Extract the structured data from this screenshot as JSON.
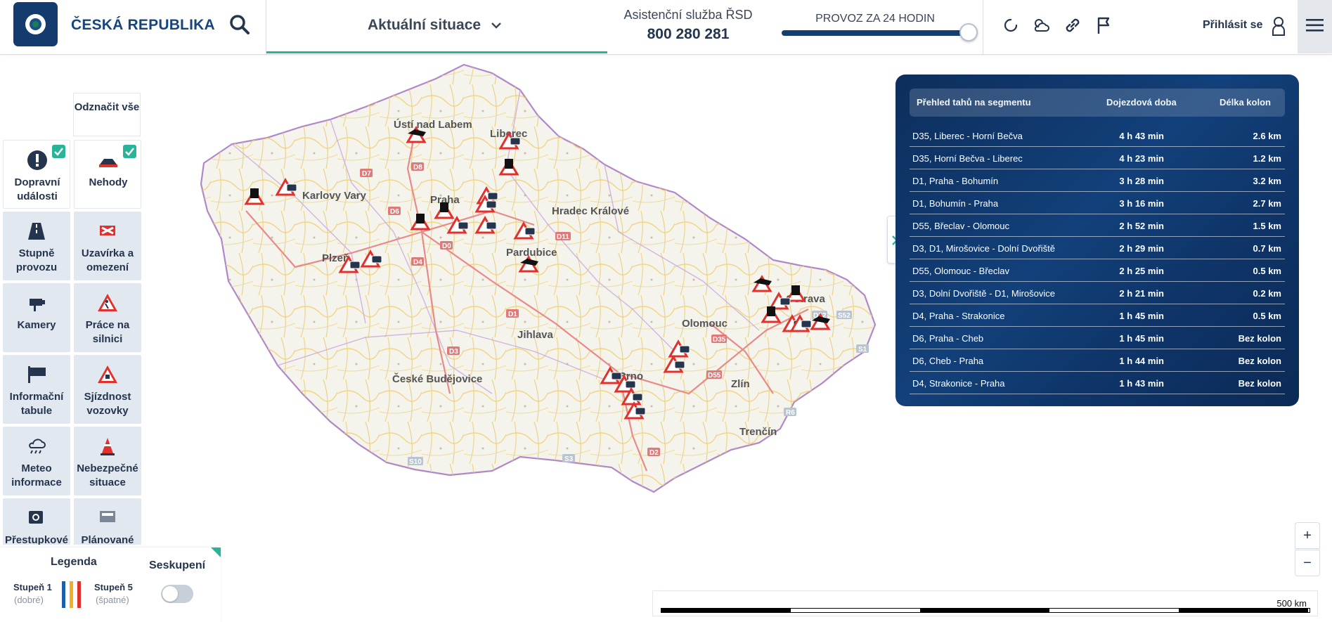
{
  "header": {
    "brand": "ČESKÁ REPUBLIKA",
    "situation_label": "Aktuální situace",
    "hotline_title": "Asistenční služba ŘSD",
    "hotline_number": "800 280 281",
    "traffic_slider_label": "PROVOZ ZA 24 HODIN",
    "traffic_slider_value": 1.0,
    "login_label": "Přihlásit se",
    "icons": [
      "search-icon",
      "chevron-down-icon",
      "refresh-icon",
      "weather-icon",
      "link-icon",
      "flag-icon",
      "user-icon",
      "hamburger-menu-icon"
    ]
  },
  "sidebar": {
    "unselect_all": "Odznačit vše",
    "tiles": [
      {
        "label": "Dopravní události",
        "icon": "exclamation-icon",
        "checked": true
      },
      {
        "label": "Nehody",
        "icon": "car-crash-icon",
        "checked": true
      },
      {
        "label": "Stupně provozu",
        "icon": "road-icon",
        "checked": false
      },
      {
        "label": "Uzavírka a omezení",
        "icon": "closure-icon",
        "checked": false
      },
      {
        "label": "Kamery",
        "icon": "camera-icon",
        "checked": false
      },
      {
        "label": "Práce na silnici",
        "icon": "roadwork-icon",
        "checked": false
      },
      {
        "label": "Informační tabule",
        "icon": "info-board-icon",
        "checked": false
      },
      {
        "label": "Sjízdnost vozovky",
        "icon": "road-condition-icon",
        "checked": false
      },
      {
        "label": "Meteo informace",
        "icon": "weather-icon",
        "checked": false
      },
      {
        "label": "Nebezpečné situace",
        "icon": "cone-icon",
        "checked": false
      },
      {
        "label": "Přestupkové",
        "icon": "speed-camera-icon",
        "checked": false
      },
      {
        "label": "Plánované",
        "icon": "planned-icon",
        "checked": false
      }
    ]
  },
  "legend": {
    "title": "Legenda",
    "level1": "Stupeň 1",
    "level1_sub": "(dobré)",
    "level5": "Stupeň 5",
    "level5_sub": "(špatné)",
    "colors": [
      "#1f5fa8",
      "#f2b01e",
      "#e0312d"
    ],
    "grouping_label": "Seskupení",
    "grouping_on": false
  },
  "segments": {
    "headers": [
      "Přehled tahů na segmentu",
      "Dojezdová doba",
      "Délka kolon"
    ],
    "rows": [
      {
        "name": "D35, Liberec - Horní Bečva",
        "time": "4 h 43 min",
        "queue": "2.6 km"
      },
      {
        "name": "D35, Horní Bečva - Liberec",
        "time": "4 h 23 min",
        "queue": "1.2 km"
      },
      {
        "name": "D1, Praha - Bohumín",
        "time": "3 h 28 min",
        "queue": "3.2 km"
      },
      {
        "name": "D1, Bohumín - Praha",
        "time": "3 h 16 min",
        "queue": "2.7 km"
      },
      {
        "name": "D55, Břeclav - Olomouc",
        "time": "2 h 52 min",
        "queue": "1.5 km"
      },
      {
        "name": "D3, D1, Mirošovice - Dolní Dvořiště",
        "time": "2 h 29 min",
        "queue": "0.7 km"
      },
      {
        "name": "D55, Olomouc - Břeclav",
        "time": "2 h 25 min",
        "queue": "0.5 km"
      },
      {
        "name": "D3, Dolní Dvořiště - D1, Mirošovice",
        "time": "2 h 21 min",
        "queue": "0.2 km"
      },
      {
        "name": "D4, Praha - Strakonice",
        "time": "1 h 45 min",
        "queue": "0.5 km"
      },
      {
        "name": "D6, Praha - Cheb",
        "time": "1 h 45 min",
        "queue": "Bez kolon"
      },
      {
        "name": "D6, Cheb - Praha",
        "time": "1 h 44 min",
        "queue": "Bez kolon"
      },
      {
        "name": "D4, Strakonice - Praha",
        "time": "1 h 43 min",
        "queue": "Bez kolon"
      }
    ]
  },
  "map": {
    "cities": [
      "Ústí nad Labem",
      "Liberec",
      "Karlovy Vary",
      "Hradec Králové",
      "Praha",
      "Plzeň",
      "Pardubice",
      "Jihlava",
      "Olomouc",
      "Ostrava",
      "České Budějovice",
      "Brno",
      "Zlín",
      "Trenčín"
    ],
    "road_labels": [
      "D7",
      "D8",
      "D6",
      "D0",
      "D4",
      "D11",
      "D1",
      "D3",
      "D35",
      "D55",
      "D2",
      "D52",
      "R6",
      "S10",
      "S3",
      "S1",
      "S52"
    ],
    "zoom_in": "+",
    "zoom_out": "−",
    "scale": "500 km"
  }
}
